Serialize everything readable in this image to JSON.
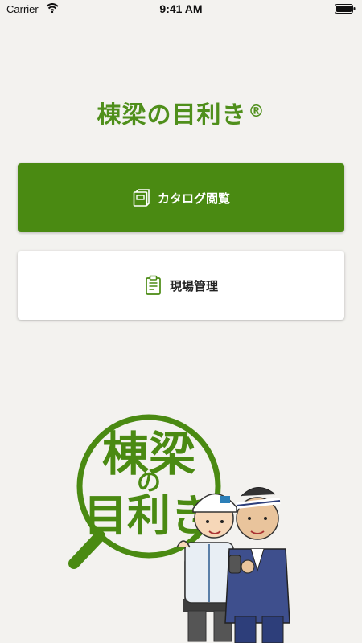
{
  "status_bar": {
    "carrier": "Carrier",
    "time": "9:41 AM"
  },
  "app": {
    "title": "棟梁の目利き",
    "registered_mark": "®",
    "accent_color": "#4a8a12"
  },
  "menu": {
    "catalog_label": "カタログ閲覧",
    "site_management_label": "現場管理"
  },
  "illustration": {
    "logo_lettering": "棟梁の目利き"
  },
  "icons": [
    "wifi-icon",
    "battery-icon",
    "catalog-book-icon",
    "clipboard-icon"
  ]
}
